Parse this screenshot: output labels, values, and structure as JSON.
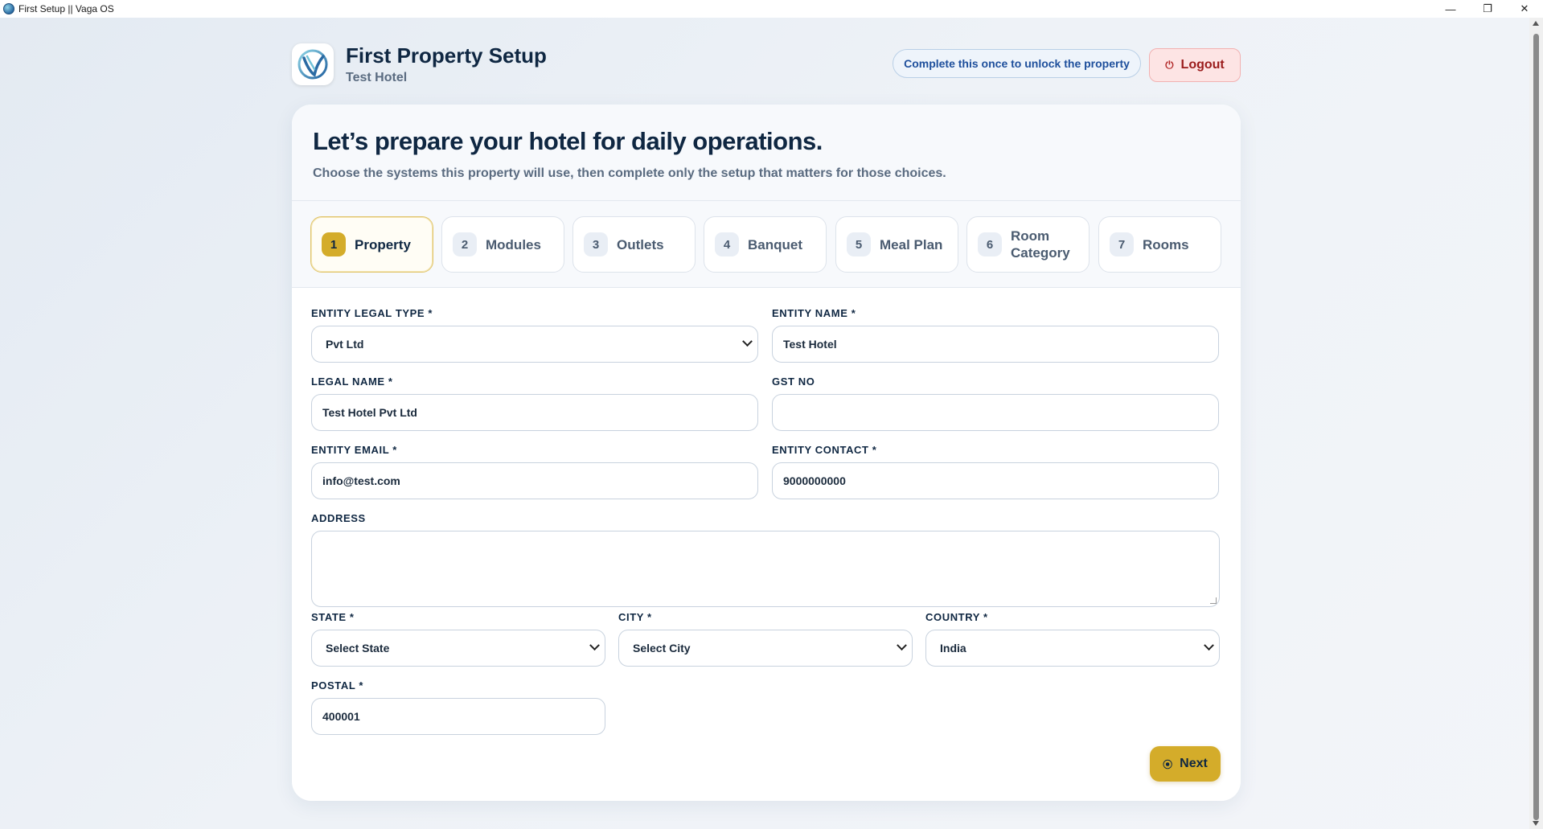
{
  "window": {
    "title": "First Setup || Vaga OS",
    "minimize": "—",
    "maximize": "❐",
    "close": "✕"
  },
  "header": {
    "title": "First Property Setup",
    "subtitle": "Test Hotel",
    "unlock_note": "Complete this once to unlock the property",
    "logout_label": "Logout"
  },
  "hero": {
    "heading": "Let’s prepare your hotel for daily operations.",
    "description": "Choose the systems this property will use, then complete only the setup that matters for those choices."
  },
  "steps": [
    {
      "num": "1",
      "label": "Property",
      "active": true
    },
    {
      "num": "2",
      "label": "Modules",
      "active": false
    },
    {
      "num": "3",
      "label": "Outlets",
      "active": false
    },
    {
      "num": "4",
      "label": "Banquet",
      "active": false
    },
    {
      "num": "5",
      "label": "Meal Plan",
      "active": false
    },
    {
      "num": "6",
      "label": "Room Category",
      "active": false
    },
    {
      "num": "7",
      "label": "Rooms",
      "active": false
    }
  ],
  "form": {
    "entity_legal_type": {
      "label": "ENTITY LEGAL TYPE *",
      "value": "Pvt Ltd"
    },
    "entity_name": {
      "label": "ENTITY NAME *",
      "value": "Test Hotel"
    },
    "legal_name": {
      "label": "LEGAL NAME *",
      "value": "Test Hotel Pvt Ltd"
    },
    "gst_no": {
      "label": "GST NO",
      "value": ""
    },
    "entity_email": {
      "label": "ENTITY EMAIL *",
      "value": "info@test.com"
    },
    "entity_contact": {
      "label": "ENTITY CONTACT *",
      "value": "9000000000"
    },
    "address": {
      "label": "ADDRESS",
      "value": ""
    },
    "state": {
      "label": "STATE *",
      "value": "Select State"
    },
    "city": {
      "label": "CITY *",
      "value": "Select City"
    },
    "country": {
      "label": "COUNTRY *",
      "value": "India"
    },
    "postal": {
      "label": "POSTAL *",
      "value": "400001"
    }
  },
  "actions": {
    "next_label": "Next"
  },
  "colors": {
    "accent_gold": "#d4ac2a",
    "navy_text": "#0f2742",
    "logout_bg": "#fde4e4",
    "logout_text": "#9a1b1b"
  }
}
